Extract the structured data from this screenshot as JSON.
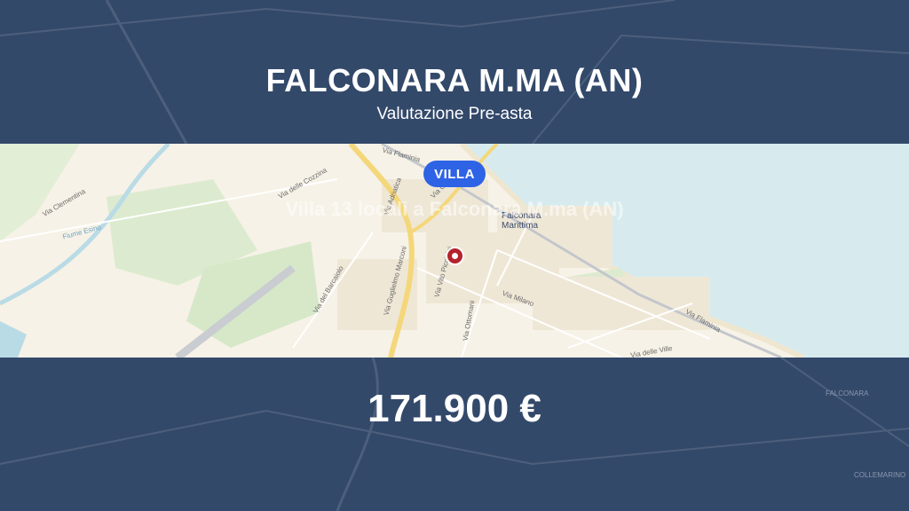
{
  "header": {
    "title": "FALCONARA M.MA (AN)",
    "subtitle": "Valutazione Pre-asta"
  },
  "listing": {
    "badge": "VILLA",
    "overlay_title": "Villa 13 locali a Falconara M.ma (AN)",
    "price": "171.900 €"
  },
  "map": {
    "town_label": "Falconara Marittima",
    "street_labels": [
      "Via Flaminia",
      "Via Goffredo",
      "Via Adriatica",
      "Via delle Cozzina",
      "Via Clementina",
      "Fiume Esino",
      "Via del Barcaiolo",
      "Via Guglielmo Marconi",
      "Via Vito Piccinini",
      "Via Ottomani",
      "Via Milano",
      "Via delle Ville"
    ],
    "outer_labels": [
      "FALCONARA",
      "COLLEMARINO"
    ],
    "colors": {
      "land": "#f7f2e7",
      "sea": "#d7ebef",
      "park": "#d9ead0",
      "road_major": "#f4d77a",
      "rail": "#c3c7cc",
      "pin": "#b4222c",
      "badge": "#2f63e6",
      "band": "#33496a"
    },
    "marker_icon": "location-pin-icon"
  }
}
